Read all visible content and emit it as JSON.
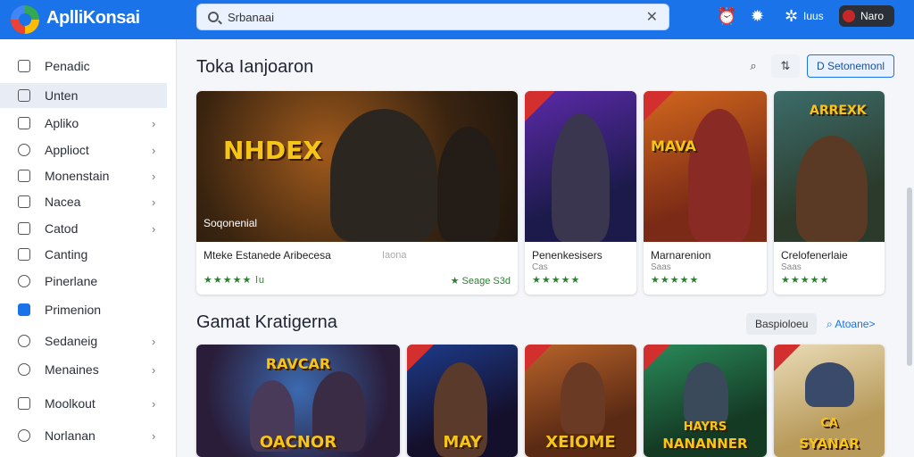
{
  "app": {
    "title": "AplliKonsai"
  },
  "search": {
    "value": "Srbanaai",
    "placeholder": ""
  },
  "topbar": {
    "link_label": "Iuus",
    "user_label": "Naro"
  },
  "sidebar": {
    "items": [
      {
        "label": "Penadic",
        "chevron": false
      },
      {
        "label": "Unten",
        "chevron": false,
        "active": true
      },
      {
        "label": "Apliko",
        "chevron": true
      },
      {
        "label": "Applioct",
        "chevron": true
      },
      {
        "label": "Monenstain",
        "chevron": true
      },
      {
        "label": "Nacea",
        "chevron": true
      },
      {
        "label": "Catod",
        "chevron": true
      },
      {
        "label": "Canting",
        "chevron": false
      },
      {
        "label": "Pinerlane",
        "chevron": false
      },
      {
        "label": "Primenion",
        "chevron": false
      },
      {
        "label": "Sedaneig",
        "chevron": true
      },
      {
        "label": "Menaines",
        "chevron": true
      },
      {
        "label": "Moolkout",
        "chevron": true
      },
      {
        "label": "Norlanan",
        "chevron": true
      }
    ]
  },
  "section1": {
    "title": "Toka Ianjoaron",
    "action_label": "D Setonemonl",
    "cards": [
      {
        "art_title": "NHDEX",
        "caption": "Soqonenial",
        "name": "Mteke Estanede Aribecesa",
        "meta": "Iaona",
        "stars": "★★★★★",
        "rating": "lu",
        "price": "★ Seage S3d"
      },
      {
        "name": "Penenkesisers",
        "sub": "Cas",
        "stars": "★★★★★"
      },
      {
        "art_title": "MAVA",
        "name": "Marnarenion",
        "sub": "Saas",
        "stars": "★★★★★"
      },
      {
        "art_title": "ARREXK",
        "name": "Crelofenerlaie",
        "sub": "Saas",
        "stars": "★★★★★"
      }
    ]
  },
  "section2": {
    "title": "Gamat Kratigerna",
    "filter_label": "Baspioloeu",
    "link_label": "Atoane>",
    "cards": [
      {
        "title": "OACNOR",
        "art_title": "RAVCAR"
      },
      {
        "title": "MAY"
      },
      {
        "title": "XEIOME"
      },
      {
        "title": "NANANNER",
        "art_title": "HAYRS"
      },
      {
        "title": "SYANAR",
        "art_title": "CA"
      }
    ]
  },
  "colors": {
    "accent": "#1a73e8",
    "ribbon": "#d32f2f",
    "rating": "#2e7d32"
  },
  "icons": [
    "search-icon",
    "close-icon",
    "notification-icon",
    "star-icon",
    "settings-icon",
    "chevron-right-icon",
    "sort-icon"
  ]
}
